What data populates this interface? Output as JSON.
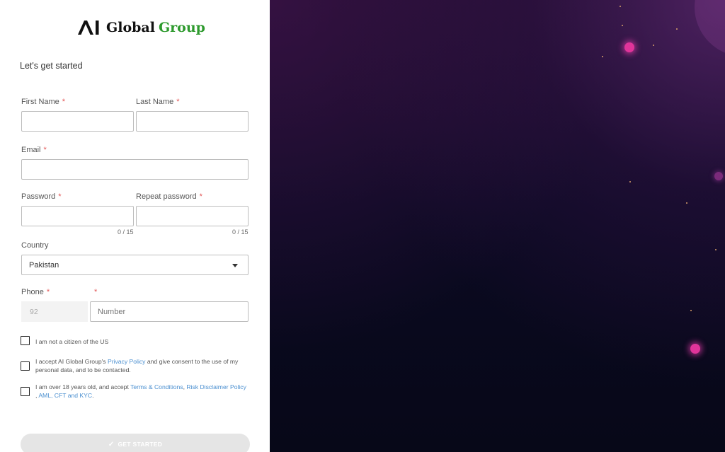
{
  "brand": {
    "mark": "AI",
    "word1": "Global",
    "word2": "Group",
    "green": "#2e9a2e"
  },
  "form": {
    "heading": "Let's get started",
    "first_name_label": "First Name",
    "last_name_label": "Last Name",
    "email_label": "Email",
    "password_label": "Password",
    "repeat_password_label": "Repeat password",
    "password_counter": "0 / 15",
    "repeat_password_counter": "0 / 15",
    "country_label": "Country",
    "country_value": "Pakistan",
    "phone_label": "Phone",
    "phone_code": "92",
    "phone_placeholder": "Number",
    "required_mark": "*"
  },
  "consents": {
    "us_citizen": "I am not a citizen of the US",
    "privacy_prefix": "I accept AI Global Group's ",
    "privacy_link": "Privacy Policy",
    "privacy_suffix": " and give consent to the use of my personal data, and to be contacted.",
    "age_prefix": "I am over 18 years old, and accept ",
    "terms_link": "Terms & Conditions",
    "sep1": ", ",
    "risk_link": "Risk Disclaimer Policy",
    "sep2": " , ",
    "aml_link": "AML, CFT and KYC",
    "age_suffix": "."
  },
  "submit": {
    "label": "GET STARTED",
    "icon": "check-icon"
  },
  "colors": {
    "link": "#4a8fd0",
    "required": "#e25555",
    "background_dark": "#0b0a22",
    "particle": "#e0349a"
  }
}
